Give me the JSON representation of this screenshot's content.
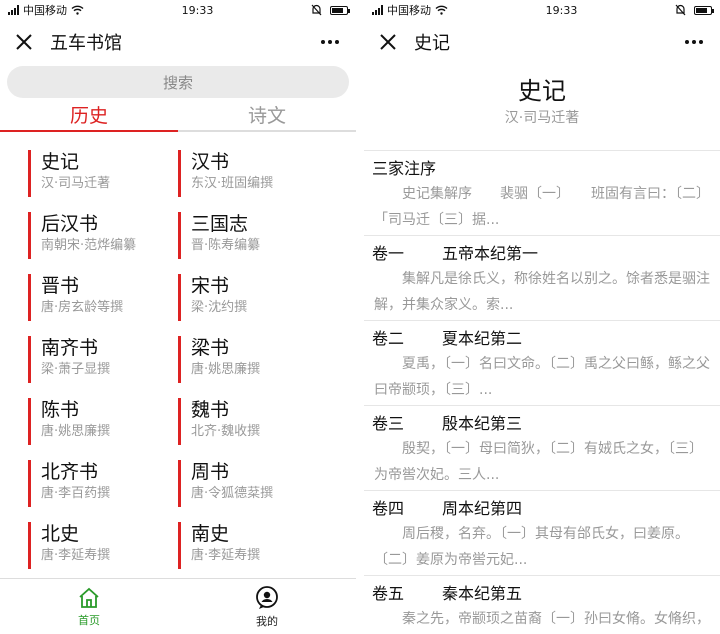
{
  "status": {
    "carrier": "中国移动",
    "time": "19:33"
  },
  "left": {
    "title": "五车书馆",
    "search_placeholder": "搜索",
    "tabs": [
      {
        "label": "历史"
      },
      {
        "label": "诗文"
      }
    ],
    "books": [
      {
        "name": "史记",
        "author": "汉·司马迁著"
      },
      {
        "name": "汉书",
        "author": "东汉·班固编撰"
      },
      {
        "name": "后汉书",
        "author": "南朝宋·范烨编纂"
      },
      {
        "name": "三国志",
        "author": "晋·陈寿编纂"
      },
      {
        "name": "晋书",
        "author": "唐·房玄龄等撰"
      },
      {
        "name": "宋书",
        "author": "梁·沈约撰"
      },
      {
        "name": "南齐书",
        "author": "梁·萧子显撰"
      },
      {
        "name": "梁书",
        "author": "唐·姚思廉撰"
      },
      {
        "name": "陈书",
        "author": "唐·姚思廉撰"
      },
      {
        "name": "魏书",
        "author": "北齐·魏收撰"
      },
      {
        "name": "北齐书",
        "author": "唐·李百药撰"
      },
      {
        "name": "周书",
        "author": "唐·令狐德棻撰"
      },
      {
        "name": "北史",
        "author": "唐·李延寿撰"
      },
      {
        "name": "南史",
        "author": "唐·李延寿撰"
      }
    ],
    "nav": [
      {
        "label": "首页"
      },
      {
        "label": "我的"
      }
    ]
  },
  "right": {
    "title": "史记",
    "book_title": "史记",
    "book_author": "汉·司马迁著",
    "chapters": [
      {
        "volume": "三家注序",
        "name": "",
        "excerpt": "史记集解序　　裴骃〔一〕　　班固有言曰：〔二〕「司马迁〔三〕据..."
      },
      {
        "volume": "卷一",
        "name": "五帝本纪第一",
        "excerpt": "集解凡是徐氏义，称徐姓名以别之。馀者悉是骃注解，并集众家义。索..."
      },
      {
        "volume": "卷二",
        "name": "夏本纪第二",
        "excerpt": "夏禹，〔一〕名曰文命。〔二〕禹之父曰鲧，鲧之父曰帝颛顼，〔三〕..."
      },
      {
        "volume": "卷三",
        "name": "殷本纪第三",
        "excerpt": "殷契，〔一〕母曰简狄，〔二〕有娀氏之女，〔三〕为帝喾次妃。三人..."
      },
      {
        "volume": "卷四",
        "name": "周本纪第四",
        "excerpt": "周后稷，名弃。〔一〕其母有邰氏女，曰姜原。〔二〕姜原为帝喾元妃..."
      },
      {
        "volume": "卷五",
        "name": "秦本纪第五",
        "excerpt": "秦之先，帝颛顼之苗裔〔一〕孙曰女脩。女脩织，玄鸟陨卵，女脩吞之..."
      }
    ]
  },
  "colors": {
    "accent": "#dd2222",
    "nav_active": "#2a9b2a"
  }
}
